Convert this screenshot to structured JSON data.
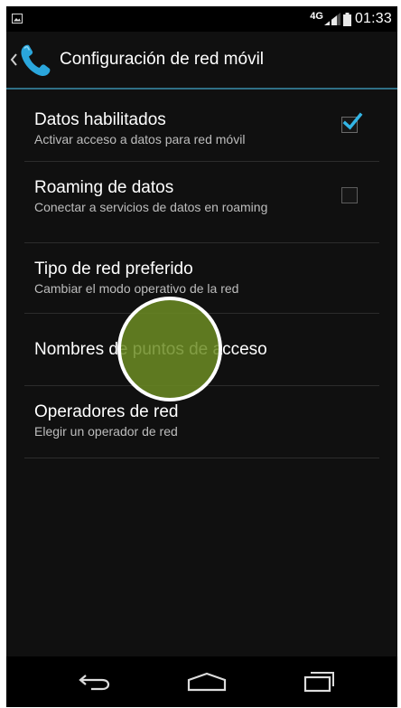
{
  "status_bar": {
    "network_type": "4G",
    "time": "01:33",
    "notification_icon": "image-notification-icon",
    "signal_icon": "signal-strength-icon",
    "battery_icon": "battery-icon"
  },
  "action_bar": {
    "back_icon": "chevron-left-icon",
    "app_icon": "phone-icon",
    "title": "Configuración de red móvil",
    "accent_color": "#2f6f86"
  },
  "settings": [
    {
      "title": "Datos habilitados",
      "summary": "Activar acceso a datos para red móvil",
      "checkbox": true,
      "checked": true
    },
    {
      "title": "Roaming de datos",
      "summary": "Conectar a servicios de datos en roaming",
      "checkbox": true,
      "checked": false
    },
    {
      "title": "Tipo de red preferido",
      "summary": "Cambiar el modo operativo de la red"
    },
    {
      "title": "Nombres de puntos de acceso",
      "summary": ""
    },
    {
      "title": "Operadores de red",
      "summary": "Elegir un operador de red"
    }
  ],
  "touch_indicator": {
    "color": "#6c8c23",
    "on_item": "Nombres de puntos de acceso"
  },
  "nav_bar": {
    "back_icon": "back-icon",
    "home_icon": "home-icon",
    "recents_icon": "recent-apps-icon"
  }
}
